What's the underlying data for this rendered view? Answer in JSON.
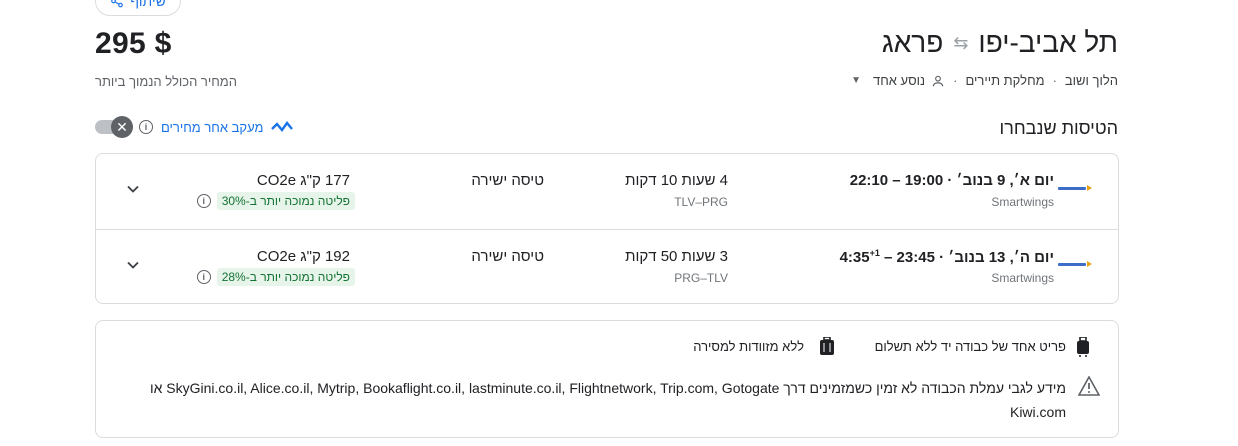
{
  "header": {
    "share_label": "שיתוף",
    "price": "295 $",
    "price_note": "המחיר הכולל הנמוך ביותר",
    "origin": "תל אביב-יפו",
    "destination": "פראג",
    "trip_type": "הלוך ושוב",
    "cabin": "מחלקת תיירים",
    "passengers": "נוסע אחד"
  },
  "selected": {
    "title": "הטיסות שנבחרו",
    "track_label": "מעקב אחר מחירים"
  },
  "flights": [
    {
      "date": "יום א׳, 9 בנוב׳",
      "time_range": "19:00 – 22:10",
      "next_day": "",
      "airline": "Smartwings",
      "duration": "4 שעות 10 דקות",
      "airports": "TLV–PRG",
      "stops": "טיסה ישירה",
      "emissions": "177 ק\"ג CO2e",
      "emissions_badge": "פליטה נמוכה יותר ב-30%"
    },
    {
      "date": "יום ה׳, 13 בנוב׳",
      "time_range": "23:45 – 4:35",
      "next_day": "+1",
      "airline": "Smartwings",
      "duration": "3 שעות 50 דקות",
      "airports": "PRG–TLV",
      "stops": "טיסה ישירה",
      "emissions": "192 ק\"ג CO2e",
      "emissions_badge": "פליטה נמוכה יותר ב-28%"
    }
  ],
  "baggage": {
    "carry_on": "פריט אחד של כבודה יד ללא תשלום",
    "checked": "ללא מזוודות למסירה",
    "notice": "מידע לגבי עמלת הכבודה לא זמין כשמזמינים דרך SkyGini.co.il, Alice.co.il, Mytrip, Bookaflight.co.il, lastminute.co.il, Flightnetwork, Trip.com, Gotogate או Kiwi.com"
  },
  "colors": {
    "accent": "#1a73e8",
    "badge_bg": "#e6f4ea",
    "badge_text": "#137333"
  }
}
